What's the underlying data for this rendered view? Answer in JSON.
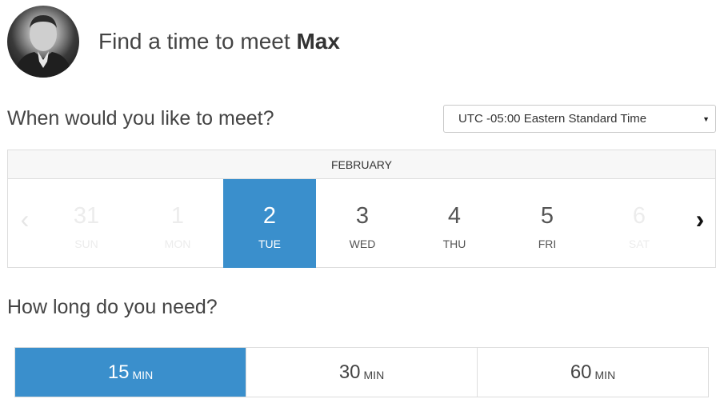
{
  "header": {
    "title_prefix": "Find a time to meet",
    "title_name": "Max"
  },
  "meet": {
    "heading": "When would you like to meet?",
    "timezone": "UTC -05:00 Eastern Standard Time"
  },
  "calendar": {
    "month": "FEBRUARY",
    "prev_label": "‹",
    "next_label": "›",
    "days": [
      {
        "num": "31",
        "dow": "SUN",
        "state": "faded"
      },
      {
        "num": "1",
        "dow": "MON",
        "state": "faded"
      },
      {
        "num": "2",
        "dow": "TUE",
        "state": "selected"
      },
      {
        "num": "3",
        "dow": "WED",
        "state": "normal"
      },
      {
        "num": "4",
        "dow": "THU",
        "state": "normal"
      },
      {
        "num": "5",
        "dow": "FRI",
        "state": "normal"
      },
      {
        "num": "6",
        "dow": "SAT",
        "state": "faded"
      }
    ]
  },
  "duration": {
    "heading": "How long do you need?",
    "options": [
      {
        "value": "15",
        "unit": "MIN",
        "selected": true
      },
      {
        "value": "30",
        "unit": "MIN",
        "selected": false
      },
      {
        "value": "60",
        "unit": "MIN",
        "selected": false
      }
    ]
  },
  "colors": {
    "accent": "#3a8fcc"
  }
}
